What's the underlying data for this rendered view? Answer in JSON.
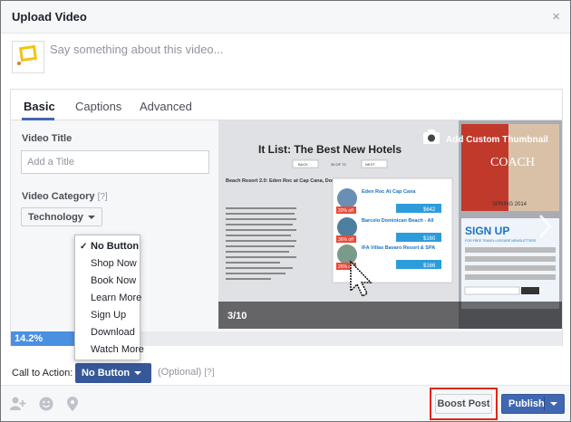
{
  "dialog": {
    "title": "Upload Video",
    "close_symbol": "×"
  },
  "composer": {
    "placeholder": "Say something about this video..."
  },
  "tabs": [
    {
      "label": "Basic"
    },
    {
      "label": "Captions"
    },
    {
      "label": "Advanced"
    }
  ],
  "form": {
    "video_title_label": "Video Title",
    "title_placeholder": "Add a Title",
    "video_category_label": "Video Category",
    "help_mark": "[?]",
    "category_value": "Technology"
  },
  "thumbnail": {
    "add_custom_label": "Add Custom Thumbnail",
    "counter": "3/10",
    "headline": "It List: The Best New Hotels",
    "nav_back": "BACK",
    "nav_count": "39 OF 72",
    "nav_next": "NEXT",
    "hotel_name": "Beach Resort 2.0: Eden Roc at Cap Cana, Dominican Republic",
    "ad_brand": "COACH",
    "ad_season": "SPRING 2014",
    "signup_title": "SIGN UP",
    "signup_sub": "FOR FREE TRAVEL+LEISURE NEWSLETTERS",
    "deals": [
      {
        "name": "Eden Roc At Cap Cana",
        "pct": "20% off",
        "price": "$642"
      },
      {
        "name": "Barcelo Dominican Beach - All",
        "pct": "36% off",
        "price": "$160"
      },
      {
        "name": "IFA Villas Bavaro Resort & SPA",
        "pct": "26% off",
        "price": "$166"
      }
    ]
  },
  "progress": {
    "label": "14.2%",
    "value": 14.2
  },
  "call_to_action": {
    "label": "Call to Action:",
    "selected": "No Button",
    "optional": "(Optional)",
    "help_mark": "[?]",
    "options": [
      "No Button",
      "Shop Now",
      "Book Now",
      "Learn More",
      "Sign Up",
      "Download",
      "Watch More"
    ]
  },
  "footer": {
    "boost_label": "Boost Post",
    "publish_label": "Publish"
  },
  "colors": {
    "brand": "#4267b2",
    "highlight": "#e0261d",
    "progress": "#4a90e2"
  }
}
